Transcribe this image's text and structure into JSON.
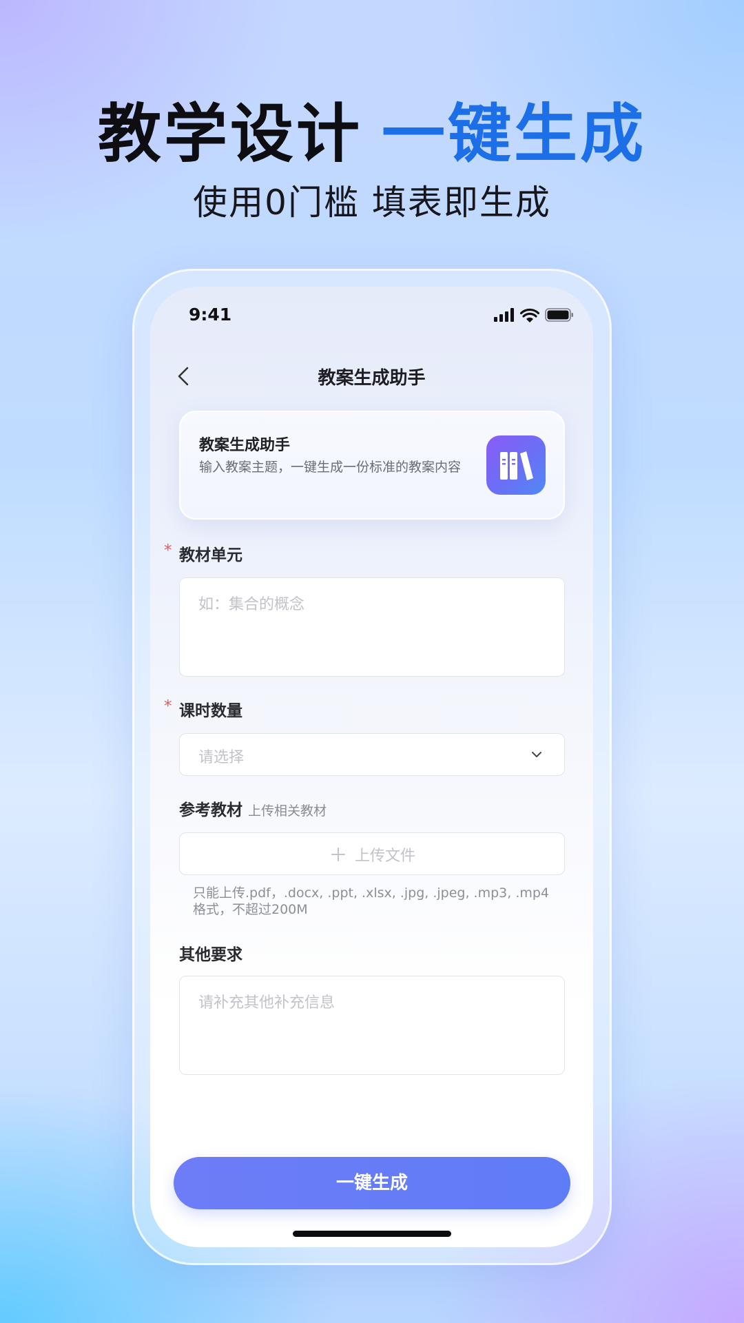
{
  "promo": {
    "headline_main": "教学设计",
    "headline_accent": "一键生成",
    "subheadline": "使用0门槛 填表即生成"
  },
  "status_bar": {
    "time": "9:41"
  },
  "nav": {
    "title": "教案生成助手"
  },
  "intro_card": {
    "title": "教案生成助手",
    "description": "输入教案主题，一键生成一份标准的教案内容"
  },
  "form": {
    "unit": {
      "label": "教材单元",
      "required_mark": "*",
      "placeholder": "如：集合的概念"
    },
    "lessons": {
      "label": "课时数量",
      "required_mark": "*",
      "placeholder": "请选择"
    },
    "reference": {
      "label": "参考教材",
      "hint": "上传相关教材",
      "upload_label": "上传文件",
      "note": "只能上传.pdf，.docx, .ppt, .xlsx, .jpg, .jpeg, .mp3, .mp4格式，不超过200M"
    },
    "other": {
      "label": "其他要求",
      "placeholder": "请补充其他补充信息"
    }
  },
  "submit_label": "一键生成",
  "colors": {
    "accent": "#1c6fe6",
    "button": "#5f7cf7",
    "required": "#f05454"
  }
}
